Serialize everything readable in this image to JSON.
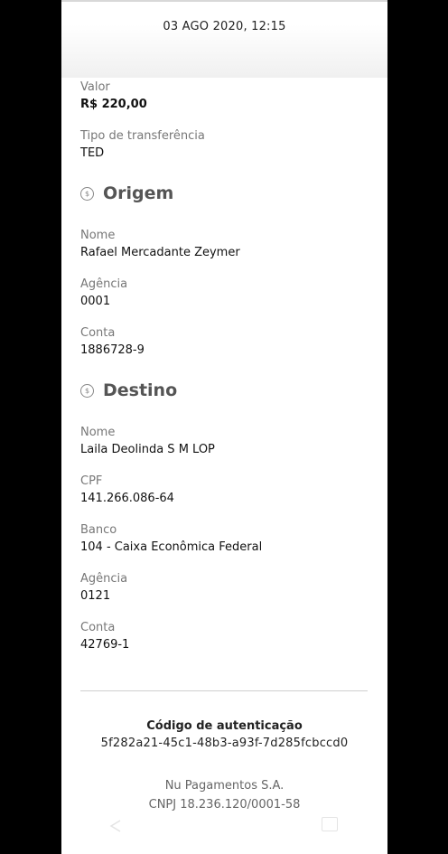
{
  "header": {
    "datetime": "03 AGO 2020, 12:15"
  },
  "transfer": {
    "valor": {
      "label": "Valor",
      "value": "R$ 220,00"
    },
    "tipo": {
      "label": "Tipo de transferência",
      "value": "TED"
    }
  },
  "origem": {
    "title": "Origem",
    "icon": "dollar-coin-icon",
    "fields": [
      {
        "label": "Nome",
        "value": "Rafael Mercadante Zeymer"
      },
      {
        "label": "Agência",
        "value": "0001"
      },
      {
        "label": "Conta",
        "value": "1886728-9"
      }
    ]
  },
  "destino": {
    "title": "Destino",
    "icon": "dollar-coin-icon",
    "fields": [
      {
        "label": "Nome",
        "value": "Laila Deolinda S M LOP"
      },
      {
        "label": "CPF",
        "value": "141.266.086-64"
      },
      {
        "label": "Banco",
        "value": "104 - Caixa Econômica Federal"
      },
      {
        "label": "Agência",
        "value": "0121"
      },
      {
        "label": "Conta",
        "value": "42769-1"
      }
    ]
  },
  "authentication": {
    "label": "Código de autenticação",
    "code": "5f282a21-45c1-48b3-a93f-7d285fcbccd0"
  },
  "footer": {
    "company": "Nu Pagamentos S.A.",
    "cnpj": "CNPJ 18.236.120/0001-58"
  },
  "colors": {
    "background": "#000000",
    "screen": "#ffffff",
    "label": "#777777",
    "section": "#555555"
  }
}
